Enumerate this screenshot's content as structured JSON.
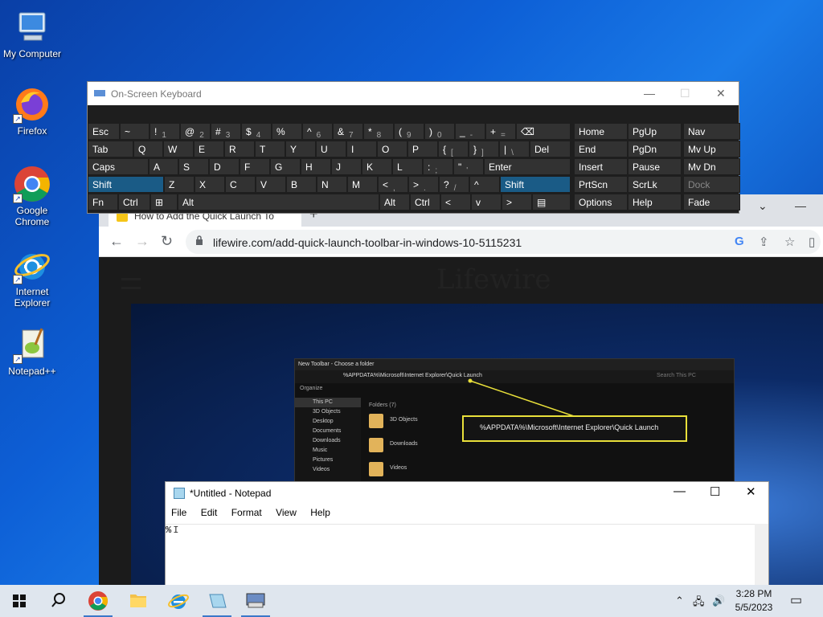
{
  "desktop": {
    "icons": [
      {
        "label": "My Computer"
      },
      {
        "label": "Firefox"
      },
      {
        "label": "Google Chrome"
      },
      {
        "label": "Internet Explorer"
      },
      {
        "label": "Notepad++"
      }
    ]
  },
  "chrome": {
    "tab_title": "How to Add the Quick Launch To",
    "url": "lifewire.com/add-quick-launch-toolbar-in-windows-10-5115231",
    "page_logo": "Lifewire",
    "screenshot": {
      "title": "New Toolbar - Choose a folder",
      "address": "%APPDATA%\\Microsoft\\Internet Explorer\\Quick Launch",
      "search": "Search This PC",
      "organize": "Organize",
      "folders_header": "Folders (7)",
      "sidebar": [
        "This PC",
        "3D Objects",
        "Desktop",
        "Documents",
        "Downloads",
        "Music",
        "Pictures",
        "Videos"
      ],
      "folders": [
        "3D Objects",
        "Downloads",
        "Videos"
      ],
      "callout": "%APPDATA%\\Microsoft\\Internet Explorer\\Quick Launch"
    }
  },
  "osk": {
    "title": "On-Screen Keyboard",
    "rows": [
      [
        "Esc",
        "~",
        "!",
        "@",
        "#",
        "$",
        "%",
        "^",
        "&",
        "*",
        "(",
        ")",
        "_",
        "+",
        "⌫"
      ],
      [
        "Tab",
        "Q",
        "W",
        "E",
        "R",
        "T",
        "Y",
        "U",
        "I",
        "O",
        "P",
        "{",
        "}",
        "|",
        "Del"
      ],
      [
        "Caps",
        "A",
        "S",
        "D",
        "F",
        "G",
        "H",
        "J",
        "K",
        "L",
        ":",
        "\"",
        "Enter"
      ],
      [
        "Shift",
        "Z",
        "X",
        "C",
        "V",
        "B",
        "N",
        "M",
        "<",
        ">",
        "?",
        "^",
        "Shift"
      ],
      [
        "Fn",
        "Ctrl",
        "⊞",
        "Alt",
        "Alt",
        "Ctrl",
        "<",
        "v",
        ">",
        "▤"
      ]
    ],
    "subs": [
      "1",
      "2",
      "3",
      "4",
      "6",
      "7",
      "8",
      "9",
      "0",
      "-",
      "=",
      "[",
      "]",
      "\\",
      ";",
      "'",
      ",",
      ".",
      "/"
    ],
    "nav_keys": [
      "Home",
      "PgUp",
      "Nav",
      "End",
      "PgDn",
      "Mv Up",
      "Insert",
      "Pause",
      "Mv Dn",
      "PrtScn",
      "ScrLk",
      "Dock",
      "Options",
      "Help",
      "Fade"
    ]
  },
  "notepad": {
    "title": "*Untitled - Notepad",
    "menu": [
      "File",
      "Edit",
      "Format",
      "View",
      "Help"
    ],
    "content": "%"
  },
  "taskbar": {
    "time": "3:28 PM",
    "date": "5/5/2023"
  }
}
